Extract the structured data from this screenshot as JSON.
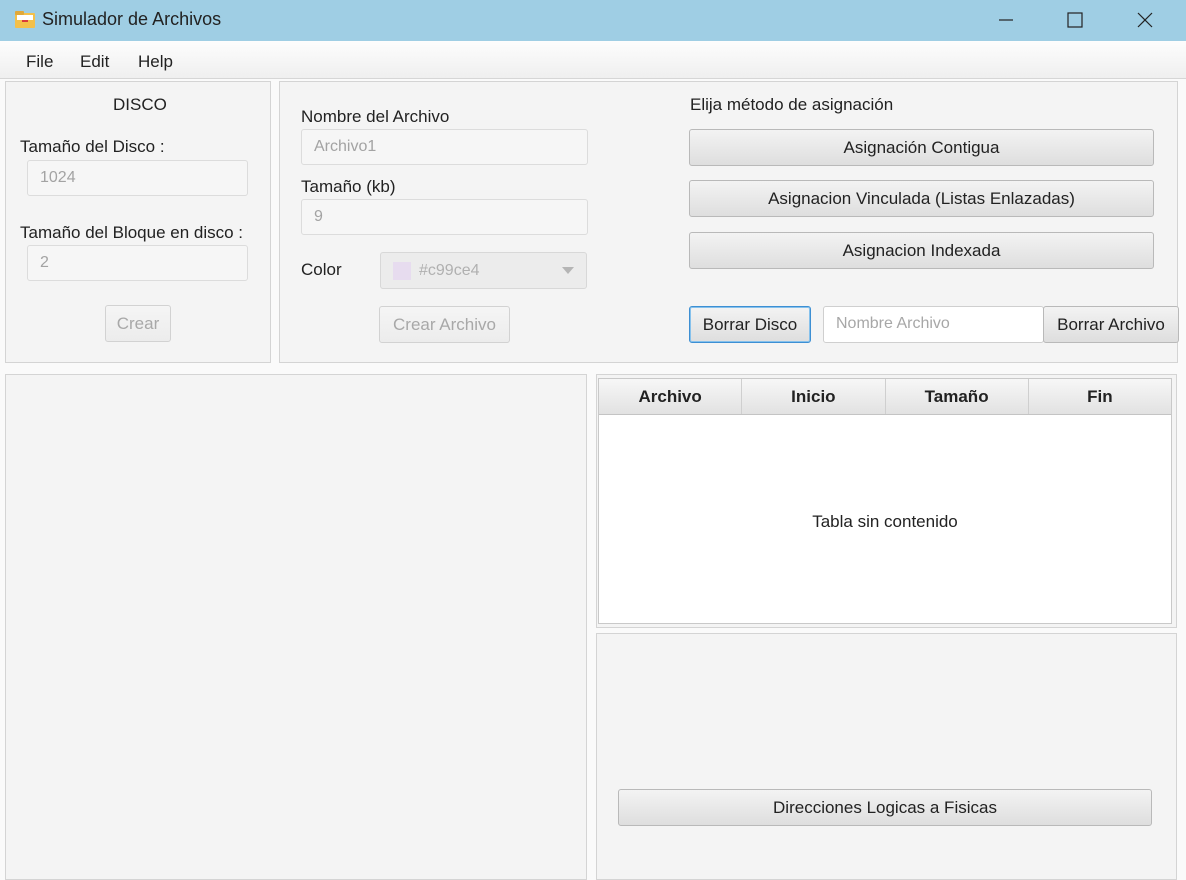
{
  "window": {
    "title": "Simulador de Archivos",
    "icon": "folder-icon"
  },
  "menu": [
    "File",
    "Edit",
    "Help"
  ],
  "disco": {
    "heading": "DISCO",
    "disk_size_label": "Tamaño del Disco :",
    "disk_size_value": "1024",
    "block_size_label": "Tamaño del Bloque en disco :",
    "block_size_value": "2",
    "create_button": "Crear"
  },
  "archivo": {
    "name_label": "Nombre del Archivo",
    "name_value": "Archivo1",
    "size_label": "Tamaño (kb)",
    "size_value": "9",
    "color_label": "Color",
    "color_value": "#c99ce4",
    "create_button": "Crear Archivo"
  },
  "asignacion": {
    "heading": "Elija método de asignación",
    "contigua_button": "Asignación Contigua",
    "vinculada_button": "Asignacion Vinculada (Listas Enlazadas)",
    "indexada_button": "Asignacion Indexada",
    "borrar_disco_button": "Borrar Disco",
    "nombre_archivo_placeholder": "Nombre Archivo",
    "borrar_archivo_button": "Borrar Archivo"
  },
  "table": {
    "columns": [
      "Archivo",
      "Inicio",
      "Tamaño",
      "Fin"
    ],
    "empty_message": "Tabla sin contenido"
  },
  "direcciones_button": "Direcciones Logicas a Fisicas"
}
